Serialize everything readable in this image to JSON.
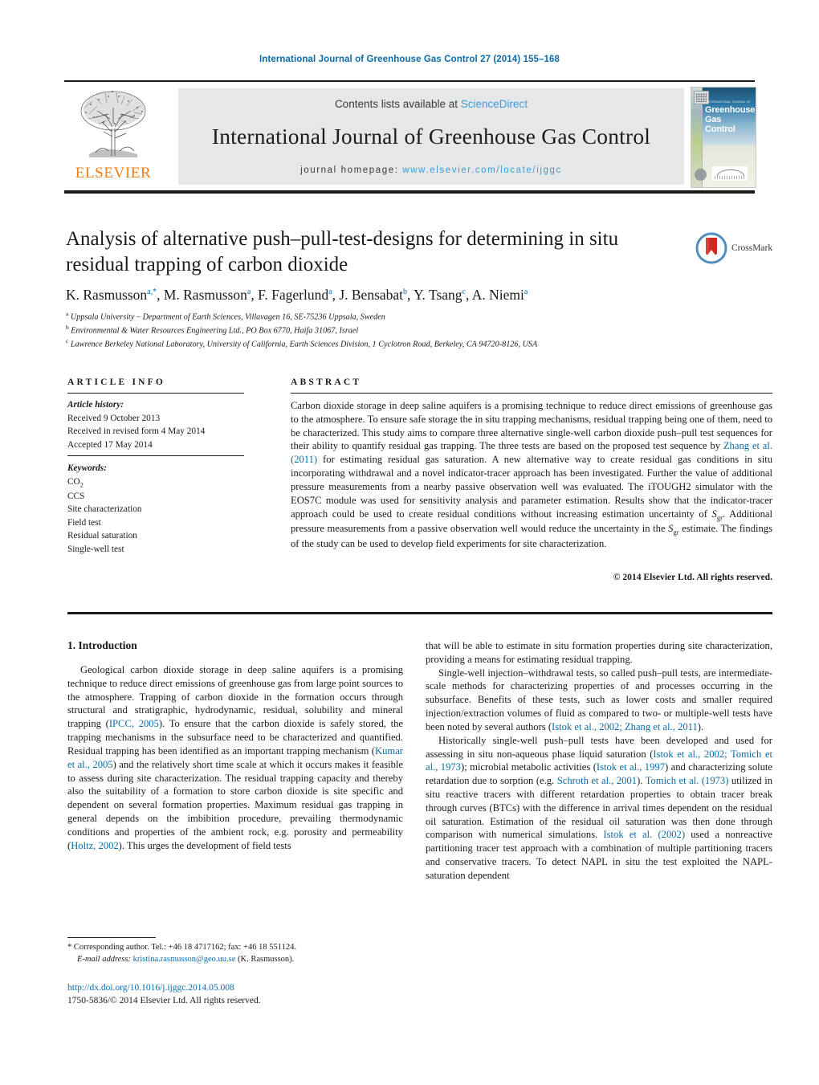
{
  "running_head": "International Journal of Greenhouse Gas Control 27 (2014) 155–168",
  "masthead": {
    "publisher": "ELSEVIER",
    "contents_prefix": "Contents lists available at ",
    "contents_link": "ScienceDirect",
    "journal_title": "International Journal of Greenhouse Gas Control",
    "homepage_prefix": "journal homepage: ",
    "homepage_link": "www.elsevier.com/locate/ijggc",
    "cover": {
      "supertitle": "INTERNATIONAL JOURNAL OF",
      "line1": "Greenhouse",
      "line2": "Gas Control"
    }
  },
  "article": {
    "title": "Analysis of alternative push–pull-test-designs for determining in situ residual trapping of carbon dioxide",
    "crossmark_label": "CrossMark",
    "authors": [
      {
        "name": "K. Rasmusson",
        "marks": "a,*"
      },
      {
        "name": "M. Rasmusson",
        "marks": "a"
      },
      {
        "name": "F. Fagerlund",
        "marks": "a"
      },
      {
        "name": "J. Bensabat",
        "marks": "b"
      },
      {
        "name": "Y. Tsang",
        "marks": "c"
      },
      {
        "name": "A. Niemi",
        "marks": "a"
      }
    ],
    "affiliations": [
      {
        "mark": "a",
        "text": "Uppsala University – Department of Earth Sciences, Villavagen 16, SE-75236 Uppsala, Sweden"
      },
      {
        "mark": "b",
        "text": "Environmental & Water Resources Engineering Ltd., PO Box 6770, Haifa 31067, Israel"
      },
      {
        "mark": "c",
        "text": "Lawrence Berkeley National Laboratory, University of California, Earth Sciences Division, 1 Cyclotron Road, Berkeley, CA 94720-8126, USA"
      }
    ]
  },
  "article_info": {
    "heading": "ARTICLE INFO",
    "history_label": "Article history:",
    "history": [
      "Received 9 October 2013",
      "Received in revised form 4 May 2014",
      "Accepted 17 May 2014"
    ],
    "keywords_label": "Keywords:",
    "keywords": [
      "CO2",
      "CCS",
      "Site characterization",
      "Field test",
      "Residual saturation",
      "Single-well test"
    ]
  },
  "abstract": {
    "heading": "ABSTRACT",
    "copyright": "© 2014 Elsevier Ltd. All rights reserved."
  },
  "introduction": {
    "heading": "1. Introduction"
  },
  "footnote": {
    "corresponding": "* Corresponding author. Tel.: +46 18 4717162; fax: +46 18 551124.",
    "email_label": "E-mail address:",
    "email": "kristina.rasmusson@geo.uu.se",
    "email_owner": "(K. Rasmusson)."
  },
  "footer": {
    "doi": "http://dx.doi.org/10.1016/j.ijggc.2014.05.008",
    "issn": "1750-5836/© 2014 Elsevier Ltd. All rights reserved."
  },
  "colors": {
    "link": "#0b6ca8",
    "sciencedirect": "#3d9bd6",
    "elsevier_orange": "#f07f13",
    "band": "#e6e7e8"
  }
}
